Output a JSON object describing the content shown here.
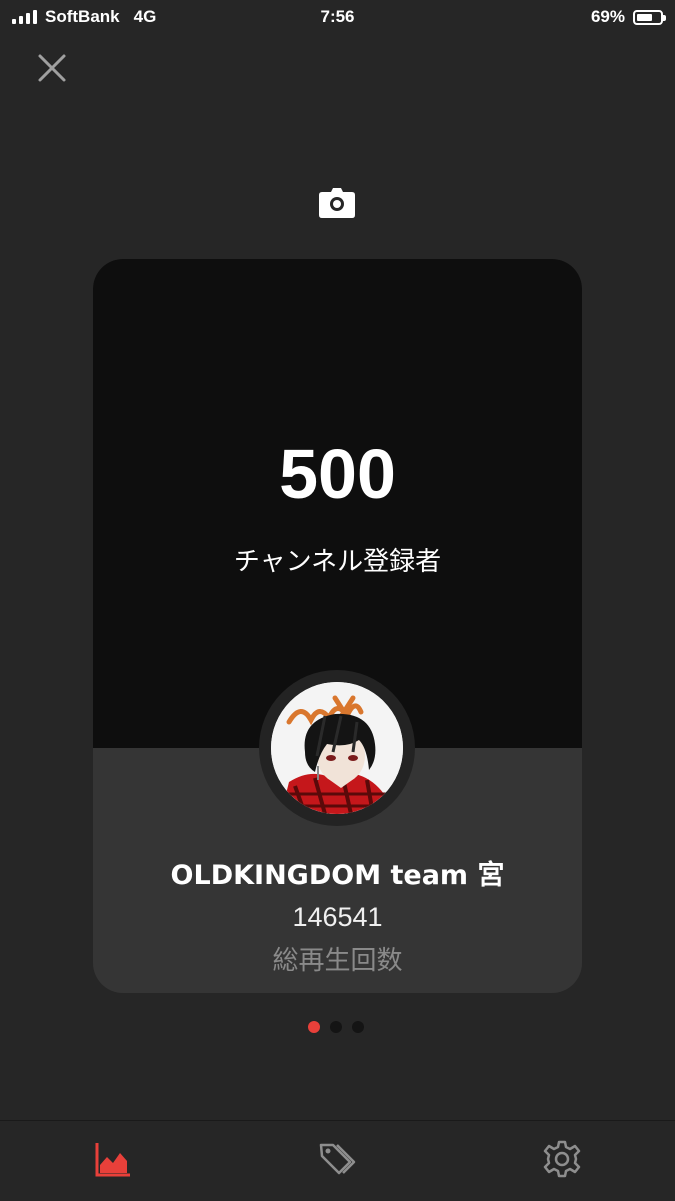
{
  "status_bar": {
    "carrier": "SoftBank",
    "network": "4G",
    "time": "7:56",
    "battery": "69%",
    "battery_level": 0.69
  },
  "card": {
    "milestone_value": "500",
    "milestone_label": "チャンネル登録者",
    "channel_name": "OLDKINGDOM team 宮",
    "total_views": "146541",
    "total_views_label": "総再生回数"
  },
  "pager": {
    "count": 3,
    "active_index": 0
  },
  "tab_bar": {
    "tabs": [
      {
        "icon": "analytics-chart-icon",
        "active": true
      },
      {
        "icon": "tag-icon",
        "active": false
      },
      {
        "icon": "gear-icon",
        "active": false
      }
    ]
  },
  "colors": {
    "background": "#262626",
    "card_top": "#0e0e0e",
    "card_bottom": "#353535",
    "accent": "#e8403a"
  }
}
